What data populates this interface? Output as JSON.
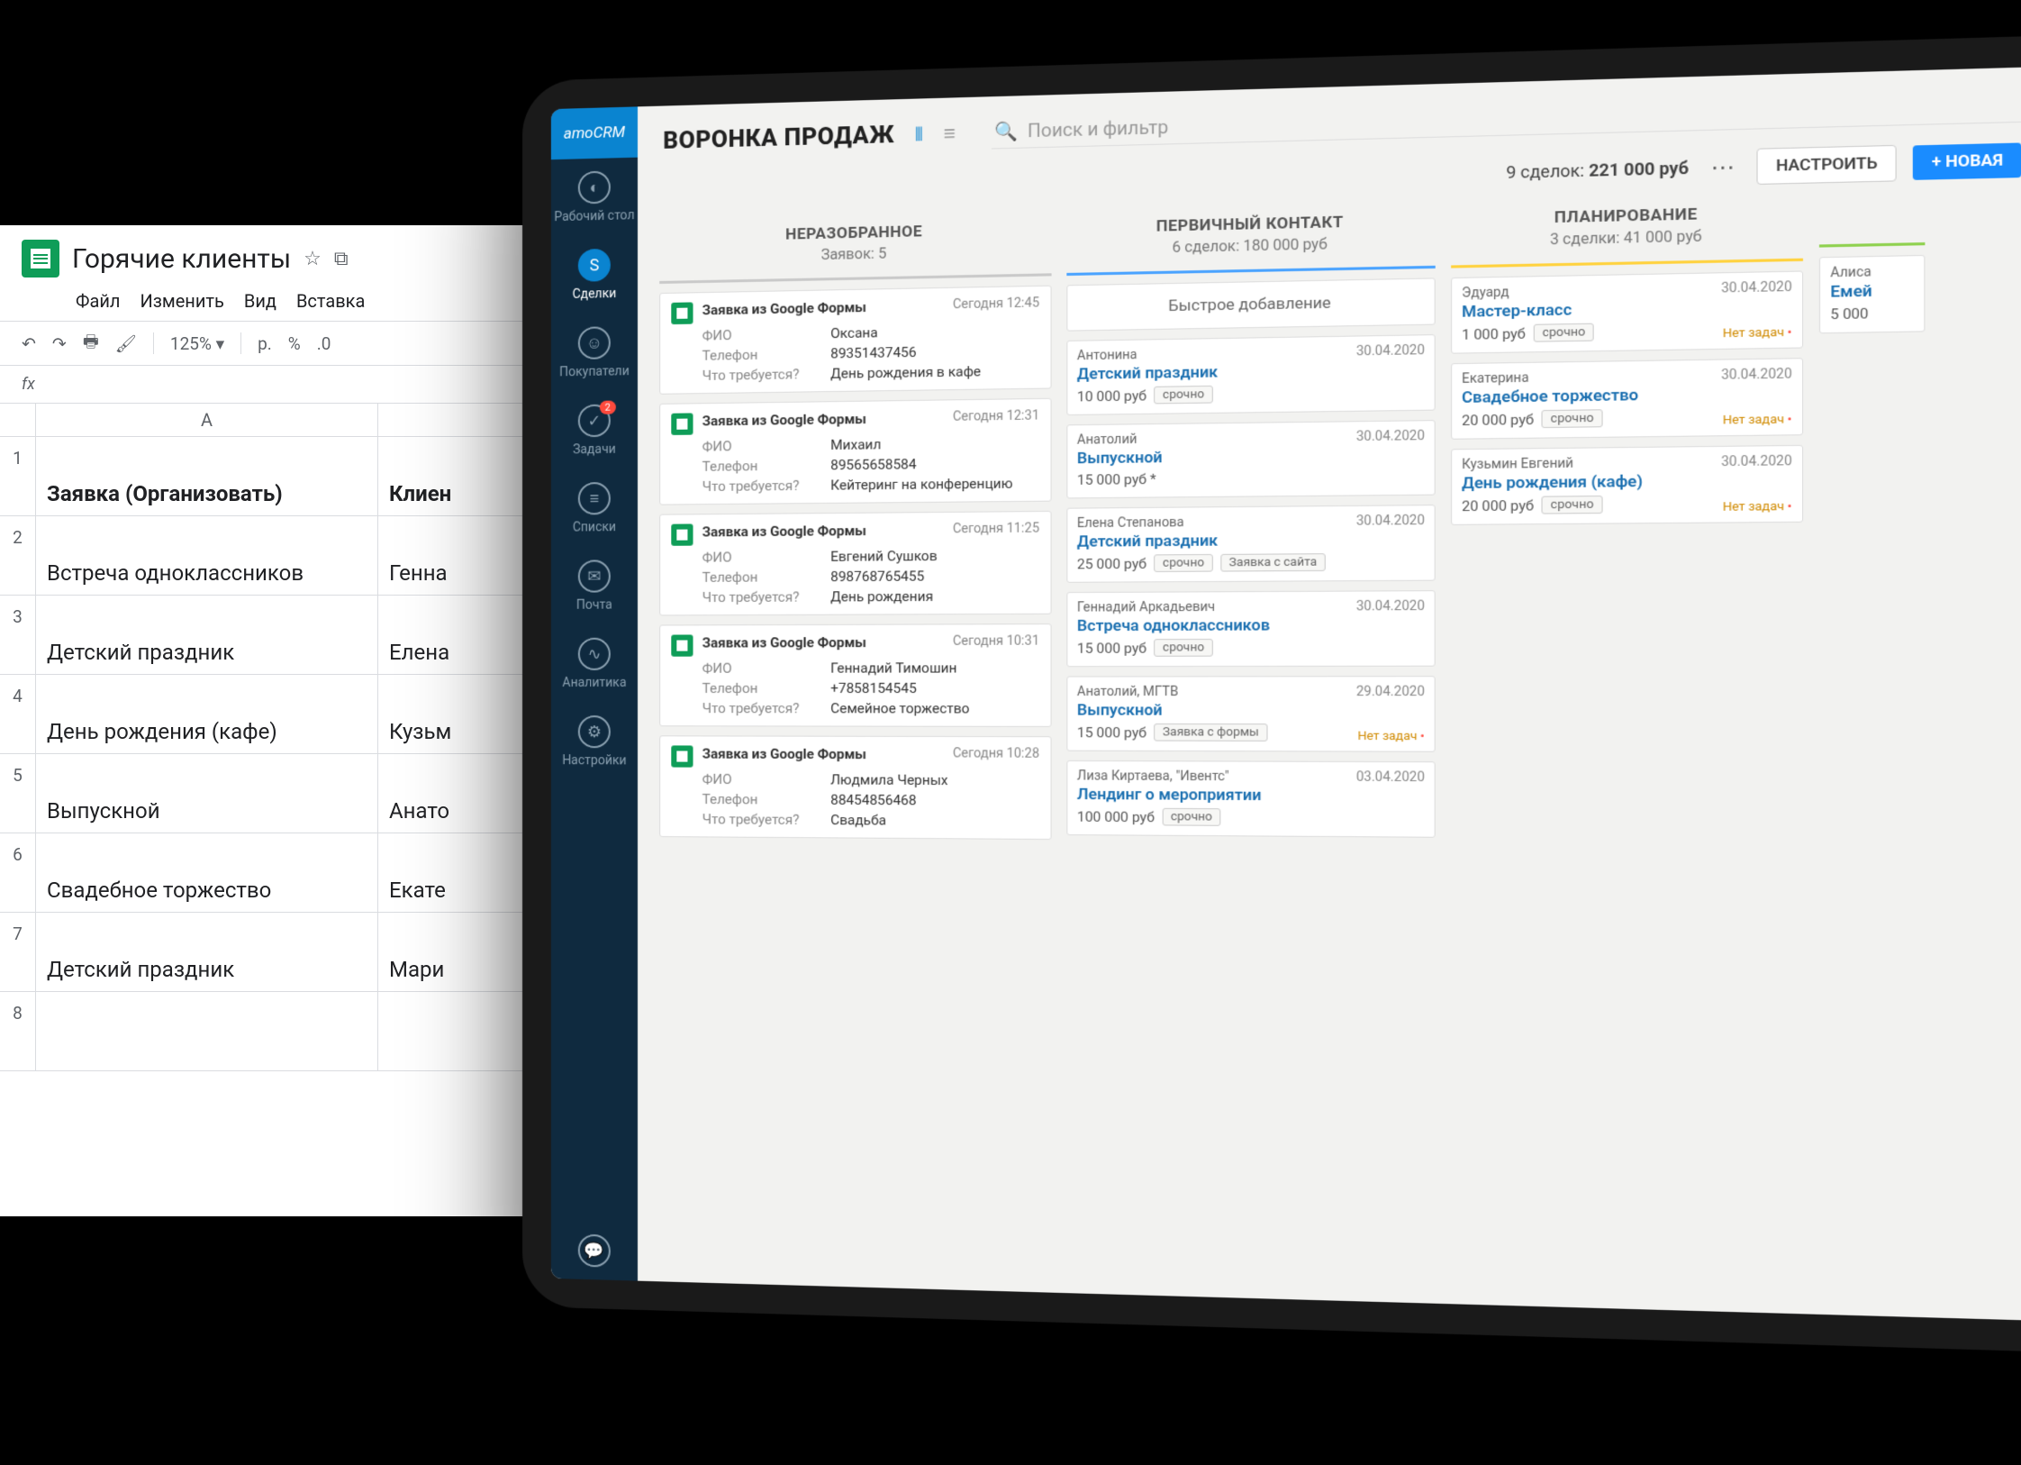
{
  "sheets": {
    "title": "Горячие клиенты",
    "menus": [
      "Файл",
      "Изменить",
      "Вид",
      "Вставка"
    ],
    "zoom": "125%",
    "currency": "р.",
    "percent": "%",
    "decimal": ".0",
    "fx": "fx",
    "col_a_label": "A",
    "header_row": {
      "a": "Заявка (Организовать)",
      "b": "Клиен"
    },
    "rows": [
      {
        "n": "2",
        "a": "Встреча одноклассников",
        "b": "Генна"
      },
      {
        "n": "3",
        "a": "Детский праздник",
        "b": "Елена"
      },
      {
        "n": "4",
        "a": "День рождения (кафе)",
        "b": "Кузьм"
      },
      {
        "n": "5",
        "a": "Выпускной",
        "b": "Анато"
      },
      {
        "n": "6",
        "a": "Свадебное торжество",
        "b": "Екате"
      },
      {
        "n": "7",
        "a": "Детский праздник",
        "b": "Мари"
      },
      {
        "n": "8",
        "a": "",
        "b": ""
      }
    ]
  },
  "crm": {
    "logo": "amoCRM",
    "nav": {
      "desktop": "Рабочий стол",
      "deals": "Сделки",
      "buyers": "Покупатели",
      "tasks": "Задачи",
      "tasks_badge": "2",
      "lists": "Списки",
      "mail": "Почта",
      "analytics": "Аналитика",
      "settings": "Настройки"
    },
    "title": "ВОРОНКА ПРОДАЖ",
    "search_placeholder": "Поиск и фильтр",
    "totals_prefix": "9 сделок:",
    "totals_sum": "221 000 руб",
    "btn_config": "НАСТРОИТЬ",
    "btn_new": "+ НОВАЯ",
    "field_labels": {
      "fio": "ФИО",
      "phone": "Телефон",
      "need": "Что требуется?"
    },
    "no_tasks": "Нет задач",
    "columns": {
      "unsorted": {
        "title": "НЕРАЗОБРАННОЕ",
        "sub": "Заявок: 5",
        "cards": [
          {
            "title": "Заявка из Google Формы",
            "time": "Сегодня 12:45",
            "fio": "Оксана",
            "phone": "89351437456",
            "need": "День рождения в кафе"
          },
          {
            "title": "Заявка из Google Формы",
            "time": "Сегодня 12:31",
            "fio": "Михаил",
            "phone": "89565658584",
            "need": "Кейтеринг на конференцию"
          },
          {
            "title": "Заявка из Google Формы",
            "time": "Сегодня 11:25",
            "fio": "Евгений Сушков",
            "phone": "898768765455",
            "need": "День рождения"
          },
          {
            "title": "Заявка из Google Формы",
            "time": "Сегодня 10:31",
            "fio": "Геннадий Тимошин",
            "phone": "+7858154545",
            "need": "Семейное торжество"
          },
          {
            "title": "Заявка из Google Формы",
            "time": "Сегодня 10:28",
            "fio": "Людмила Черных",
            "phone": "88454856468",
            "need": "Свадьба"
          }
        ]
      },
      "primary": {
        "title": "ПЕРВИЧНЫЙ КОНТАКТ",
        "sub": "6 сделок: 180 000 руб",
        "quick_add": "Быстрое добавление",
        "cards": [
          {
            "contact": "Антонина",
            "date": "30.04.2020",
            "deal": "Детский праздник",
            "price": "10 000 руб",
            "tags": [
              "срочно"
            ]
          },
          {
            "contact": "Анатолий",
            "date": "30.04.2020",
            "deal": "Выпускной",
            "price": "15 000 руб *",
            "tags": []
          },
          {
            "contact": "Елена Степанова",
            "date": "30.04.2020",
            "deal": "Детский праздник",
            "price": "25 000 руб",
            "tags": [
              "срочно",
              "Заявка с сайта"
            ]
          },
          {
            "contact": "Геннадий Аркадьевич",
            "date": "30.04.2020",
            "deal": "Встреча одноклассников",
            "price": "15 000 руб",
            "tags": [
              "срочно"
            ]
          },
          {
            "contact": "Анатолий, МГТВ",
            "date": "29.04.2020",
            "deal": "Выпускной",
            "price": "15 000 руб",
            "tags": [
              "Заявка с формы"
            ],
            "no_tasks": true
          },
          {
            "contact": "Лиза Киртаева, \"Ивентс\"",
            "date": "03.04.2020",
            "deal": "Лендинг о мероприятии",
            "price": "100 000 руб",
            "tags": [
              "срочно"
            ]
          }
        ]
      },
      "planning": {
        "title": "ПЛАНИРОВАНИЕ",
        "sub": "3 сделки: 41 000 руб",
        "cards": [
          {
            "contact": "Эдуард",
            "date": "30.04.2020",
            "deal": "Мастер-класс",
            "price": "1 000 руб",
            "tags": [
              "срочно"
            ],
            "no_tasks": true
          },
          {
            "contact": "Екатерина",
            "date": "30.04.2020",
            "deal": "Свадебное торжество",
            "price": "20 000 руб",
            "tags": [
              "срочно"
            ],
            "no_tasks": true
          },
          {
            "contact": "Кузьмин Евгений",
            "date": "30.04.2020",
            "deal": "День рождения (кафе)",
            "price": "20 000 руб",
            "tags": [
              "срочно"
            ],
            "no_tasks": true
          }
        ]
      },
      "peek": {
        "cards": [
          {
            "contact": "Алиса",
            "deal": "Емей",
            "price": "5 000"
          }
        ]
      }
    }
  }
}
